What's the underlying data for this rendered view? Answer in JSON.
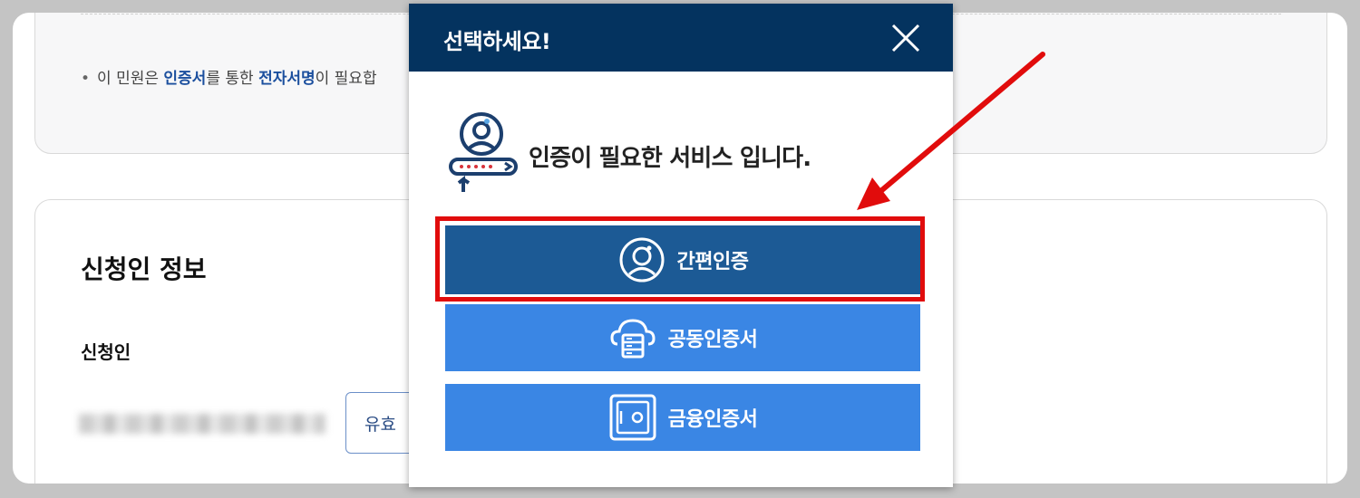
{
  "notice": {
    "bullet": "•",
    "part1": "이 민원은 ",
    "em1": "인증서",
    "part2": "를 통한 ",
    "em2": "전자서명",
    "part3": "이 필요합"
  },
  "applicant": {
    "section_title": "신청인 정보",
    "field_label": "신청인",
    "validity_button": "유효"
  },
  "modal": {
    "title": "선택하세요!",
    "message": "인증이 필요한 서비스 입니다.",
    "buttons": [
      {
        "label": "간편인증",
        "icon": "user-circle-icon"
      },
      {
        "label": "공동인증서",
        "icon": "cloud-server-icon"
      },
      {
        "label": "금융인증서",
        "icon": "safe-icon"
      }
    ]
  },
  "colors": {
    "header": "#04335f",
    "simple_auth": "#1c5a95",
    "certificate_buttons": "#3a86e4",
    "highlight": "#e10c0c"
  }
}
